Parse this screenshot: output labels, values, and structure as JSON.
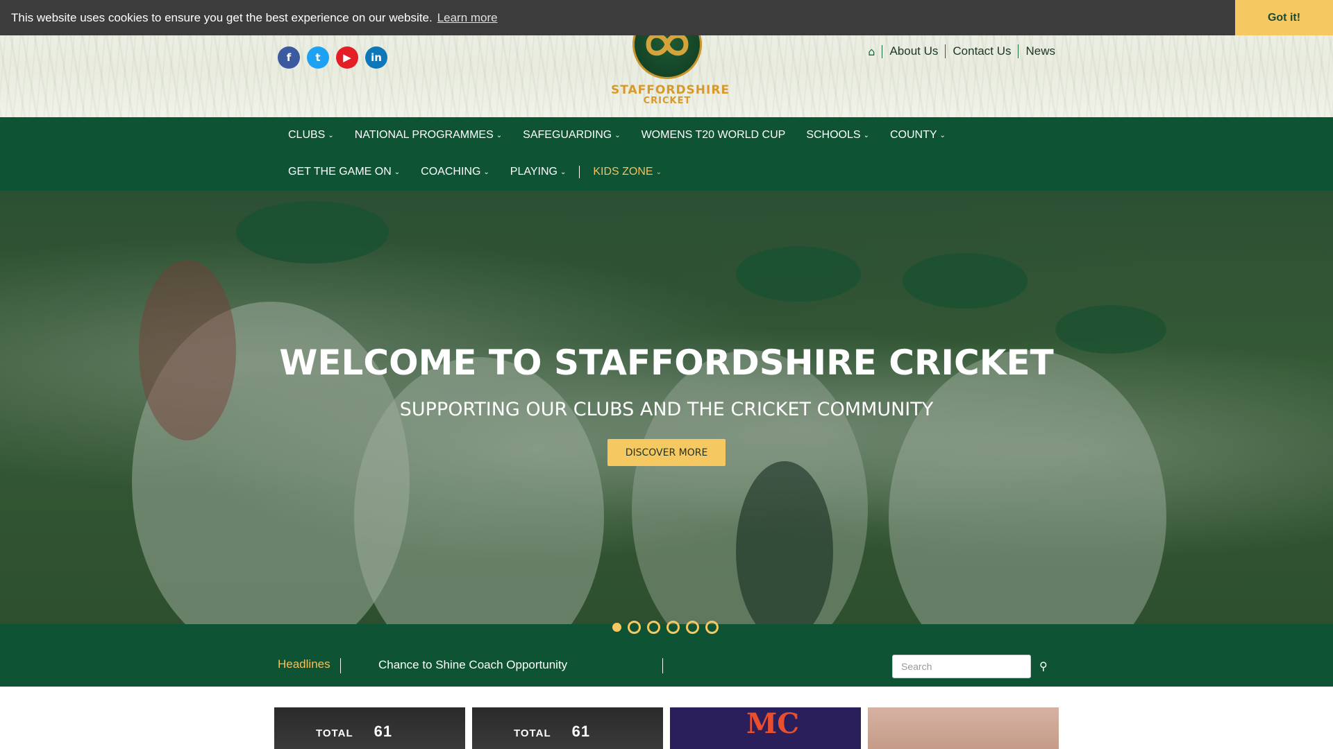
{
  "cookie": {
    "message": "This website uses cookies to ensure you get the best experience on our website.",
    "learn_more": "Learn more",
    "accept": "Got it!"
  },
  "social": {
    "facebook": "f",
    "twitter": "t",
    "youtube": "▶",
    "linkedin": "in"
  },
  "logo": {
    "line1": "STAFFORDSHIRE",
    "line2": "CRICKET"
  },
  "toplinks": {
    "home_icon": "home-icon",
    "about": "About Us",
    "contact": "Contact Us",
    "news": "News"
  },
  "nav": {
    "row1": [
      "CLUBS",
      "NATIONAL PROGRAMMES",
      "SAFEGUARDING",
      "WOMENS T20 WORLD CUP",
      "SCHOOLS",
      "COUNTY"
    ],
    "row2": [
      "GET THE GAME ON",
      "COACHING",
      "PLAYING",
      "KIDS ZONE"
    ]
  },
  "hero": {
    "title": "WELCOME TO STAFFORDSHIRE CRICKET",
    "subtitle": "SUPPORTING OUR CLUBS AND THE CRICKET COMMUNITY",
    "button": "DISCOVER MORE"
  },
  "slider": {
    "count": 6,
    "active_index": 0
  },
  "headlines": {
    "label": "Headlines",
    "current": "Chance to Shine Coach Opportunity"
  },
  "search": {
    "placeholder": "Search"
  },
  "cards": {
    "c1_scoreboard": "TOTAL",
    "c1_score": "61",
    "c2_scoreboard": "TOTAL",
    "c2_score": "61",
    "c3_logo": "MC"
  },
  "colors": {
    "brand_green": "#0f5335",
    "accent_gold": "#f6c862",
    "nav_highlight": "#f4c15c"
  }
}
